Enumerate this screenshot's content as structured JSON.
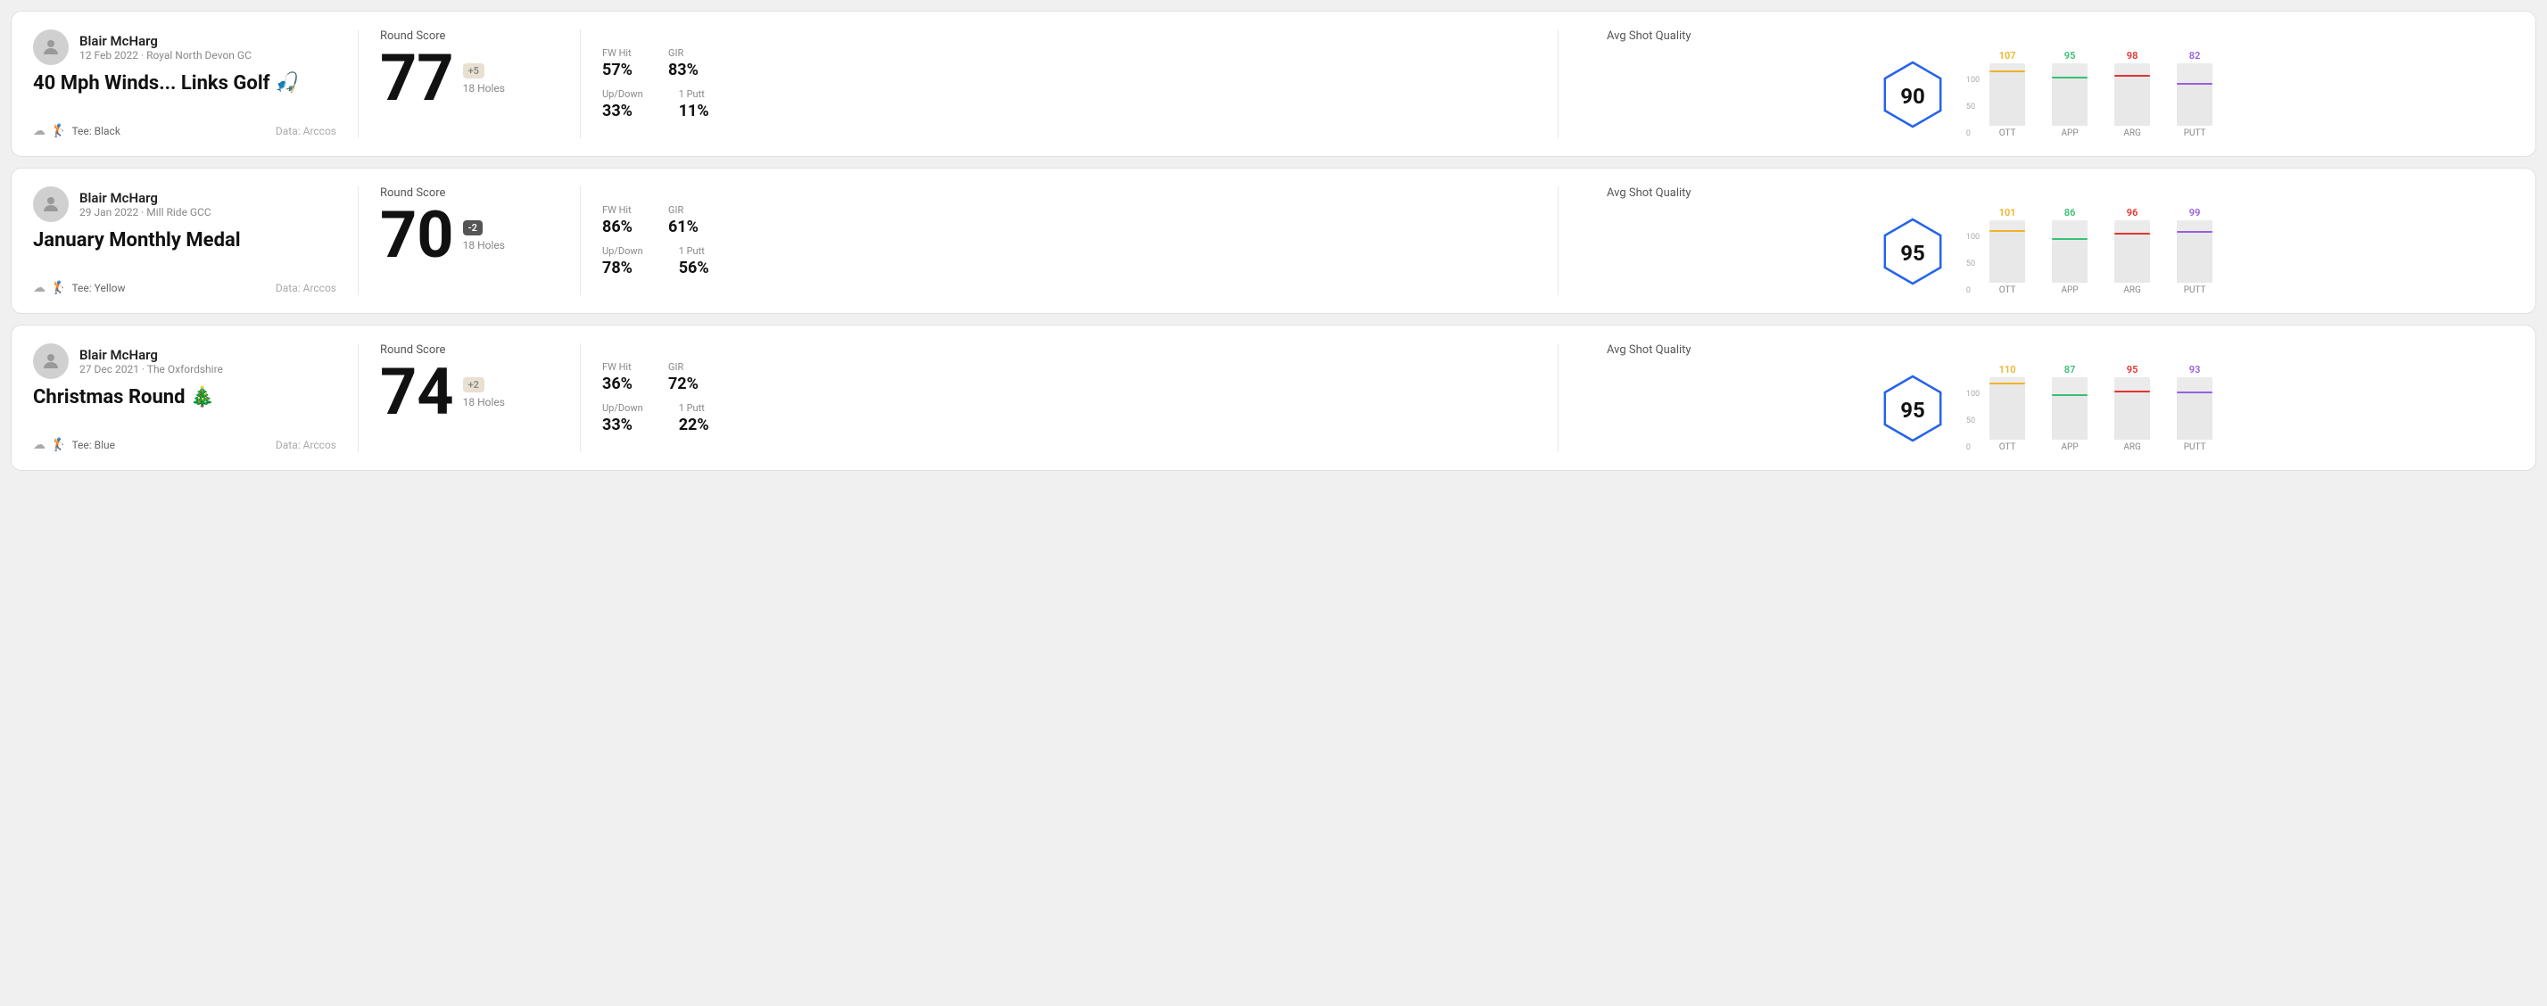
{
  "cards": [
    {
      "id": "card1",
      "user": {
        "name": "Blair McHarg",
        "date": "12 Feb 2022 · Royal North Devon GC"
      },
      "title": "40 Mph Winds... Links Golf 🎣",
      "tee": "Black",
      "data_source": "Data: Arccos",
      "score": {
        "label": "Round Score",
        "number": "77",
        "badge": "+5",
        "badge_type": "positive",
        "holes": "18 Holes"
      },
      "stats": {
        "fw_hit_label": "FW Hit",
        "fw_hit_value": "57%",
        "gir_label": "GIR",
        "gir_value": "83%",
        "up_down_label": "Up/Down",
        "up_down_value": "33%",
        "one_putt_label": "1 Putt",
        "one_putt_value": "11%"
      },
      "quality": {
        "label": "Avg Shot Quality",
        "score": "90",
        "bars": [
          {
            "label": "OTT",
            "value": 107,
            "color": "#f0b429",
            "max": 120
          },
          {
            "label": "APP",
            "value": 95,
            "color": "#38c172",
            "max": 120
          },
          {
            "label": "ARG",
            "value": 98,
            "color": "#e3342f",
            "max": 120
          },
          {
            "label": "PUTT",
            "value": 82,
            "color": "#9561e2",
            "max": 120
          }
        ]
      }
    },
    {
      "id": "card2",
      "user": {
        "name": "Blair McHarg",
        "date": "29 Jan 2022 · Mill Ride GCC"
      },
      "title": "January Monthly Medal",
      "tee": "Yellow",
      "data_source": "Data: Arccos",
      "score": {
        "label": "Round Score",
        "number": "70",
        "badge": "-2",
        "badge_type": "negative",
        "holes": "18 Holes"
      },
      "stats": {
        "fw_hit_label": "FW Hit",
        "fw_hit_value": "86%",
        "gir_label": "GIR",
        "gir_value": "61%",
        "up_down_label": "Up/Down",
        "up_down_value": "78%",
        "one_putt_label": "1 Putt",
        "one_putt_value": "56%"
      },
      "quality": {
        "label": "Avg Shot Quality",
        "score": "95",
        "bars": [
          {
            "label": "OTT",
            "value": 101,
            "color": "#f0b429",
            "max": 120
          },
          {
            "label": "APP",
            "value": 86,
            "color": "#38c172",
            "max": 120
          },
          {
            "label": "ARG",
            "value": 96,
            "color": "#e3342f",
            "max": 120
          },
          {
            "label": "PUTT",
            "value": 99,
            "color": "#9561e2",
            "max": 120
          }
        ]
      }
    },
    {
      "id": "card3",
      "user": {
        "name": "Blair McHarg",
        "date": "27 Dec 2021 · The Oxfordshire"
      },
      "title": "Christmas Round 🎄",
      "tee": "Blue",
      "data_source": "Data: Arccos",
      "score": {
        "label": "Round Score",
        "number": "74",
        "badge": "+2",
        "badge_type": "positive",
        "holes": "18 Holes"
      },
      "stats": {
        "fw_hit_label": "FW Hit",
        "fw_hit_value": "36%",
        "gir_label": "GIR",
        "gir_value": "72%",
        "up_down_label": "Up/Down",
        "up_down_value": "33%",
        "one_putt_label": "1 Putt",
        "one_putt_value": "22%"
      },
      "quality": {
        "label": "Avg Shot Quality",
        "score": "95",
        "bars": [
          {
            "label": "OTT",
            "value": 110,
            "color": "#f0b429",
            "max": 120
          },
          {
            "label": "APP",
            "value": 87,
            "color": "#38c172",
            "max": 120
          },
          {
            "label": "ARG",
            "value": 95,
            "color": "#e3342f",
            "max": 120
          },
          {
            "label": "PUTT",
            "value": 93,
            "color": "#9561e2",
            "max": 120
          }
        ]
      }
    }
  ],
  "y_axis_labels": [
    "100",
    "50",
    "0"
  ]
}
